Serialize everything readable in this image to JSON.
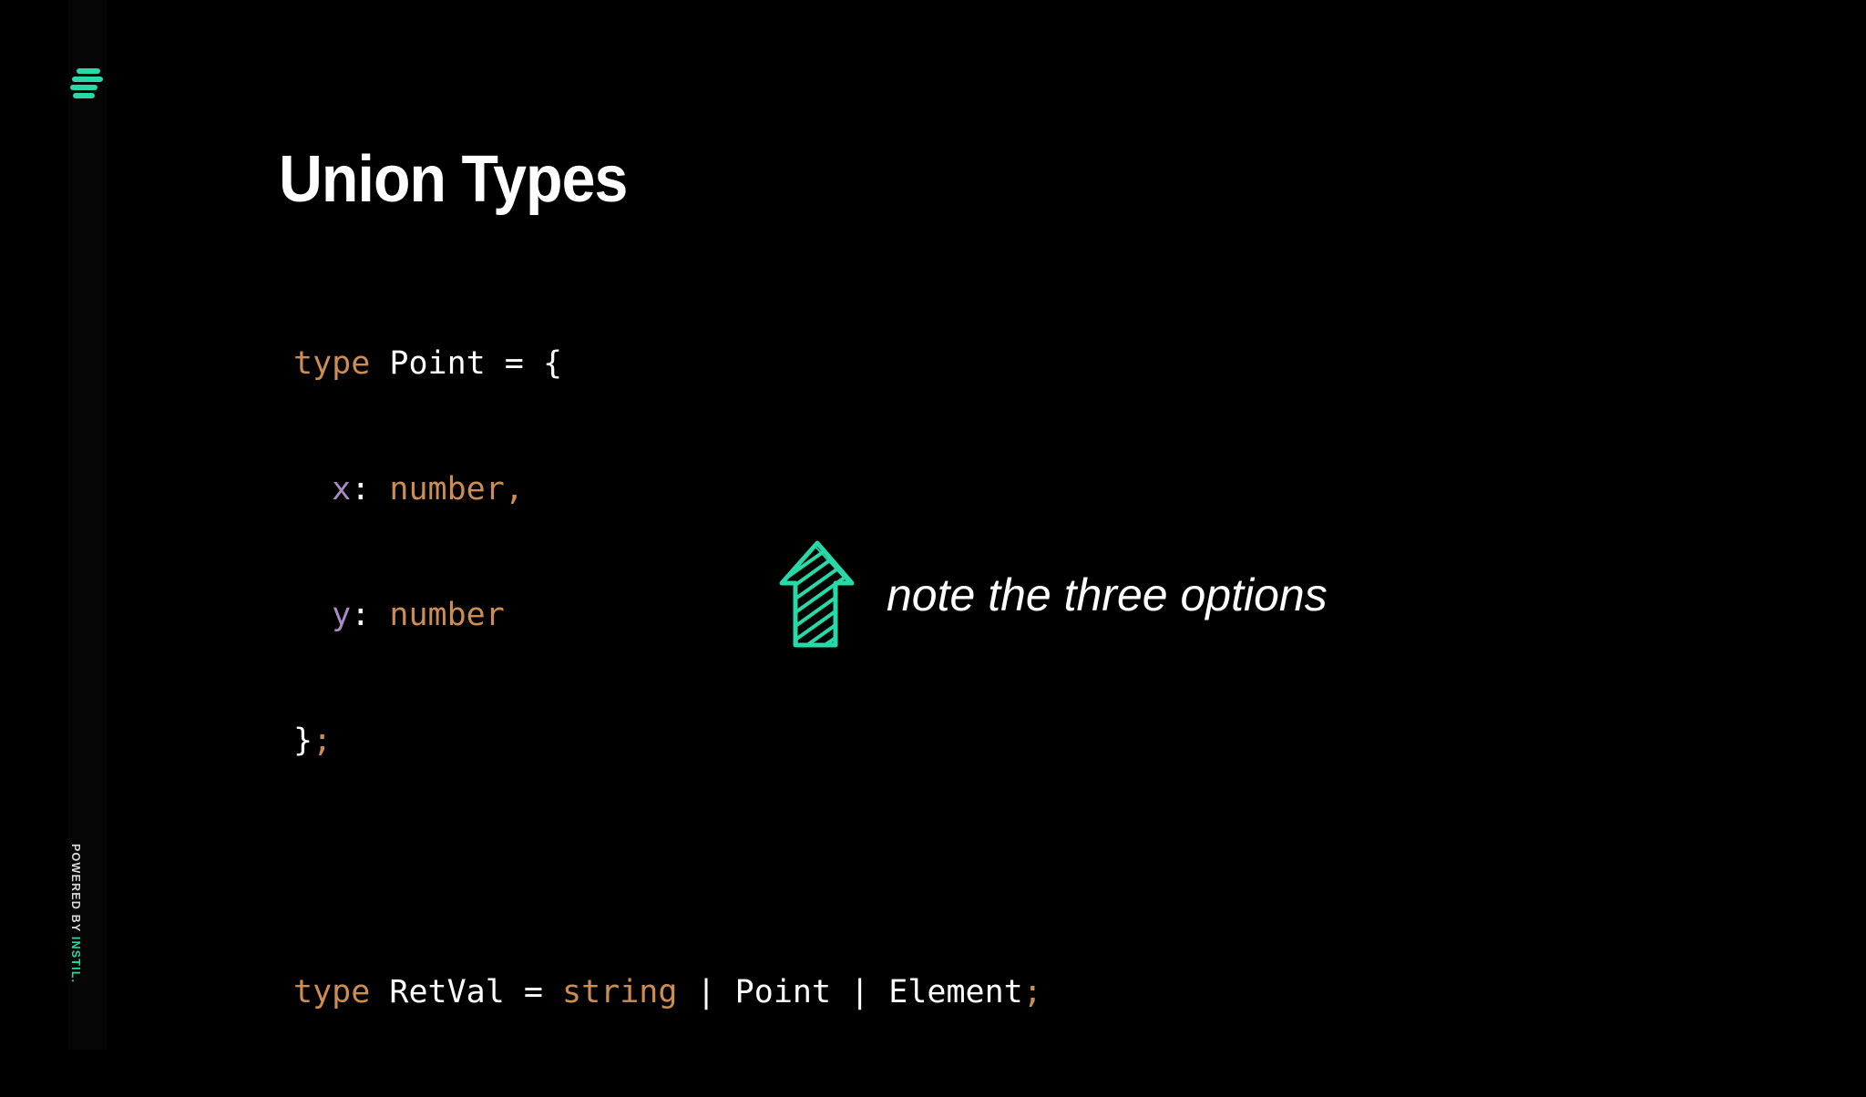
{
  "slide": {
    "title": "Union Types",
    "code": {
      "line1": {
        "kw": "type",
        "name": " Point = {"
      },
      "line2": {
        "indent": "  ",
        "prop": "x",
        "colon": ": ",
        "type": "number,",
        "rest": ""
      },
      "line3": {
        "indent": "  ",
        "prop": "y",
        "colon": ": ",
        "type": "number",
        "rest": ""
      },
      "line4": {
        "brace": "}",
        "semi": ";"
      },
      "line6": {
        "kw": "type",
        "name": " RetVal = ",
        "type1": "string",
        "sep1": " | ",
        "type2": "Point",
        "sep2": " | ",
        "type3": "Element",
        "semi": ";"
      }
    },
    "note": "note the three options",
    "footer": {
      "powered_by": "POWERED BY ",
      "brand": "INSTIL."
    }
  },
  "colors": {
    "background": "#000000",
    "keyword": "#cc8c52",
    "property": "#a98bc3",
    "text": "#ffffff",
    "accent": "#27d9a6"
  },
  "icons": {
    "logo": "instil-logo-icon",
    "arrow": "up-arrow-icon"
  }
}
